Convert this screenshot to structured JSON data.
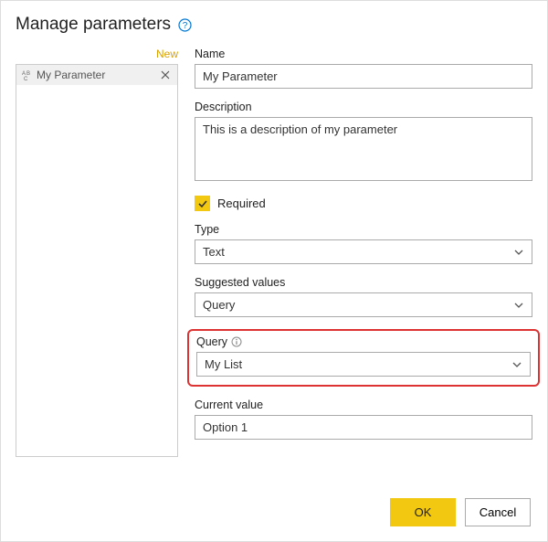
{
  "header": {
    "title": "Manage parameters"
  },
  "sidebar": {
    "new_label": "New",
    "items": [
      {
        "type_glyph": "ABC",
        "label": "My Parameter"
      }
    ]
  },
  "form": {
    "name_label": "Name",
    "name_value": "My Parameter",
    "description_label": "Description",
    "description_value": "This is a description of my parameter",
    "required_label": "Required",
    "required_checked": true,
    "type_label": "Type",
    "type_value": "Text",
    "suggested_label": "Suggested values",
    "suggested_value": "Query",
    "query_label": "Query",
    "query_value": "My List",
    "current_label": "Current value",
    "current_value": "Option 1"
  },
  "footer": {
    "ok_label": "OK",
    "cancel_label": "Cancel"
  }
}
